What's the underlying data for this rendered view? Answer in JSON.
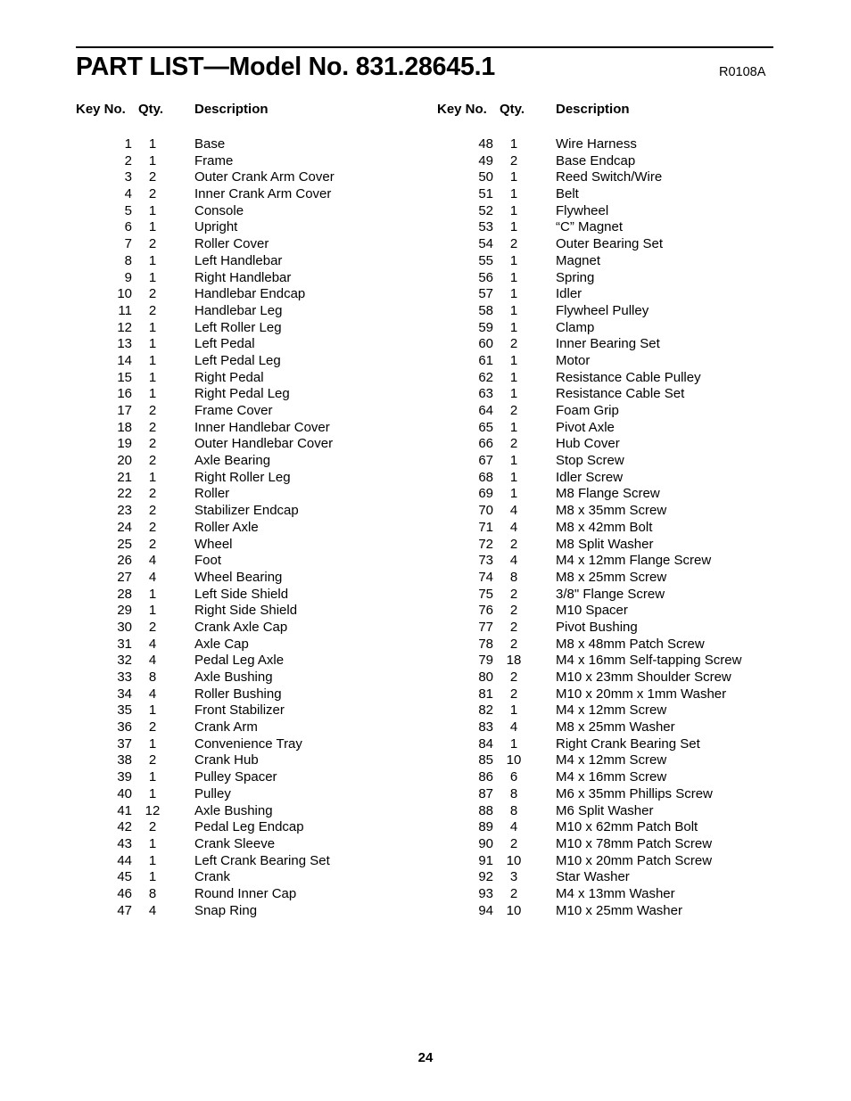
{
  "document": {
    "title": "PART LIST—Model No. 831.28645.1",
    "revision_code": "R0108A",
    "page_number": "24"
  },
  "columns": {
    "headers": {
      "key_no": "Key No.",
      "qty": "Qty.",
      "description": "Description"
    }
  },
  "parts_left": [
    {
      "key": "1",
      "qty": "1",
      "desc": "Base"
    },
    {
      "key": "2",
      "qty": "1",
      "desc": "Frame"
    },
    {
      "key": "3",
      "qty": "2",
      "desc": "Outer Crank Arm Cover"
    },
    {
      "key": "4",
      "qty": "2",
      "desc": "Inner Crank Arm Cover"
    },
    {
      "key": "5",
      "qty": "1",
      "desc": "Console"
    },
    {
      "key": "6",
      "qty": "1",
      "desc": "Upright"
    },
    {
      "key": "7",
      "qty": "2",
      "desc": "Roller Cover"
    },
    {
      "key": "8",
      "qty": "1",
      "desc": "Left Handlebar"
    },
    {
      "key": "9",
      "qty": "1",
      "desc": "Right Handlebar"
    },
    {
      "key": "10",
      "qty": "2",
      "desc": "Handlebar Endcap"
    },
    {
      "key": "11",
      "qty": "2",
      "desc": "Handlebar Leg"
    },
    {
      "key": "12",
      "qty": "1",
      "desc": "Left Roller Leg"
    },
    {
      "key": "13",
      "qty": "1",
      "desc": "Left Pedal"
    },
    {
      "key": "14",
      "qty": "1",
      "desc": "Left Pedal Leg"
    },
    {
      "key": "15",
      "qty": "1",
      "desc": "Right Pedal"
    },
    {
      "key": "16",
      "qty": "1",
      "desc": "Right Pedal Leg"
    },
    {
      "key": "17",
      "qty": "2",
      "desc": "Frame Cover"
    },
    {
      "key": "18",
      "qty": "2",
      "desc": "Inner Handlebar Cover"
    },
    {
      "key": "19",
      "qty": "2",
      "desc": "Outer Handlebar Cover"
    },
    {
      "key": "20",
      "qty": "2",
      "desc": "Axle Bearing"
    },
    {
      "key": "21",
      "qty": "1",
      "desc": "Right Roller Leg"
    },
    {
      "key": "22",
      "qty": "2",
      "desc": "Roller"
    },
    {
      "key": "23",
      "qty": "2",
      "desc": "Stabilizer Endcap"
    },
    {
      "key": "24",
      "qty": "2",
      "desc": "Roller Axle"
    },
    {
      "key": "25",
      "qty": "2",
      "desc": "Wheel"
    },
    {
      "key": "26",
      "qty": "4",
      "desc": "Foot"
    },
    {
      "key": "27",
      "qty": "4",
      "desc": "Wheel Bearing"
    },
    {
      "key": "28",
      "qty": "1",
      "desc": "Left Side Shield"
    },
    {
      "key": "29",
      "qty": "1",
      "desc": "Right Side Shield"
    },
    {
      "key": "30",
      "qty": "2",
      "desc": "Crank Axle Cap"
    },
    {
      "key": "31",
      "qty": "4",
      "desc": "Axle Cap"
    },
    {
      "key": "32",
      "qty": "4",
      "desc": "Pedal Leg Axle"
    },
    {
      "key": "33",
      "qty": "8",
      "desc": "Axle Bushing"
    },
    {
      "key": "34",
      "qty": "4",
      "desc": "Roller Bushing"
    },
    {
      "key": "35",
      "qty": "1",
      "desc": "Front Stabilizer"
    },
    {
      "key": "36",
      "qty": "2",
      "desc": "Crank Arm"
    },
    {
      "key": "37",
      "qty": "1",
      "desc": "Convenience Tray"
    },
    {
      "key": "38",
      "qty": "2",
      "desc": "Crank Hub"
    },
    {
      "key": "39",
      "qty": "1",
      "desc": "Pulley Spacer"
    },
    {
      "key": "40",
      "qty": "1",
      "desc": "Pulley"
    },
    {
      "key": "41",
      "qty": "12",
      "desc": "Axle Bushing"
    },
    {
      "key": "42",
      "qty": "2",
      "desc": "Pedal Leg Endcap"
    },
    {
      "key": "43",
      "qty": "1",
      "desc": "Crank Sleeve"
    },
    {
      "key": "44",
      "qty": "1",
      "desc": "Left Crank Bearing Set"
    },
    {
      "key": "45",
      "qty": "1",
      "desc": "Crank"
    },
    {
      "key": "46",
      "qty": "8",
      "desc": "Round Inner Cap"
    },
    {
      "key": "47",
      "qty": "4",
      "desc": "Snap Ring"
    }
  ],
  "parts_right": [
    {
      "key": "48",
      "qty": "1",
      "desc": "Wire Harness"
    },
    {
      "key": "49",
      "qty": "2",
      "desc": "Base Endcap"
    },
    {
      "key": "50",
      "qty": "1",
      "desc": "Reed Switch/Wire"
    },
    {
      "key": "51",
      "qty": "1",
      "desc": "Belt"
    },
    {
      "key": "52",
      "qty": "1",
      "desc": "Flywheel"
    },
    {
      "key": "53",
      "qty": "1",
      "desc": "“C” Magnet"
    },
    {
      "key": "54",
      "qty": "2",
      "desc": "Outer Bearing Set"
    },
    {
      "key": "55",
      "qty": "1",
      "desc": "Magnet"
    },
    {
      "key": "56",
      "qty": "1",
      "desc": "Spring"
    },
    {
      "key": "57",
      "qty": "1",
      "desc": "Idler"
    },
    {
      "key": "58",
      "qty": "1",
      "desc": "Flywheel Pulley"
    },
    {
      "key": "59",
      "qty": "1",
      "desc": "Clamp"
    },
    {
      "key": "60",
      "qty": "2",
      "desc": "Inner Bearing Set"
    },
    {
      "key": "61",
      "qty": "1",
      "desc": "Motor"
    },
    {
      "key": "62",
      "qty": "1",
      "desc": "Resistance Cable Pulley"
    },
    {
      "key": "63",
      "qty": "1",
      "desc": "Resistance Cable Set"
    },
    {
      "key": "64",
      "qty": "2",
      "desc": "Foam Grip"
    },
    {
      "key": "65",
      "qty": "1",
      "desc": "Pivot Axle"
    },
    {
      "key": "66",
      "qty": "2",
      "desc": "Hub Cover"
    },
    {
      "key": "67",
      "qty": "1",
      "desc": "Stop Screw"
    },
    {
      "key": "68",
      "qty": "1",
      "desc": "Idler Screw"
    },
    {
      "key": "69",
      "qty": "1",
      "desc": "M8 Flange Screw"
    },
    {
      "key": "70",
      "qty": "4",
      "desc": "M8 x 35mm Screw"
    },
    {
      "key": "71",
      "qty": "4",
      "desc": "M8 x 42mm Bolt"
    },
    {
      "key": "72",
      "qty": "2",
      "desc": "M8 Split Washer"
    },
    {
      "key": "73",
      "qty": "4",
      "desc": "M4 x 12mm Flange Screw"
    },
    {
      "key": "74",
      "qty": "8",
      "desc": "M8 x 25mm Screw"
    },
    {
      "key": "75",
      "qty": "2",
      "desc": "3/8\" Flange Screw"
    },
    {
      "key": "76",
      "qty": "2",
      "desc": "M10 Spacer"
    },
    {
      "key": "77",
      "qty": "2",
      "desc": "Pivot Bushing"
    },
    {
      "key": "78",
      "qty": "2",
      "desc": "M8 x 48mm Patch Screw"
    },
    {
      "key": "79",
      "qty": "18",
      "desc": "M4 x 16mm Self-tapping Screw"
    },
    {
      "key": "80",
      "qty": "2",
      "desc": "M10 x 23mm Shoulder Screw"
    },
    {
      "key": "81",
      "qty": "2",
      "desc": "M10 x 20mm x 1mm Washer"
    },
    {
      "key": "82",
      "qty": "1",
      "desc": "M4 x 12mm Screw"
    },
    {
      "key": "83",
      "qty": "4",
      "desc": "M8 x 25mm Washer"
    },
    {
      "key": "84",
      "qty": "1",
      "desc": "Right Crank Bearing Set"
    },
    {
      "key": "85",
      "qty": "10",
      "desc": "M4 x 12mm Screw"
    },
    {
      "key": "86",
      "qty": "6",
      "desc": "M4 x 16mm Screw"
    },
    {
      "key": "87",
      "qty": "8",
      "desc": "M6 x 35mm Phillips Screw"
    },
    {
      "key": "88",
      "qty": "8",
      "desc": "M6 Split Washer"
    },
    {
      "key": "89",
      "qty": "4",
      "desc": "M10 x 62mm Patch Bolt"
    },
    {
      "key": "90",
      "qty": "2",
      "desc": "M10 x 78mm Patch Screw"
    },
    {
      "key": "91",
      "qty": "10",
      "desc": "M10 x 20mm Patch Screw"
    },
    {
      "key": "92",
      "qty": "3",
      "desc": "Star Washer"
    },
    {
      "key": "93",
      "qty": "2",
      "desc": "M4 x 13mm Washer"
    },
    {
      "key": "94",
      "qty": "10",
      "desc": "M10 x 25mm Washer"
    }
  ]
}
